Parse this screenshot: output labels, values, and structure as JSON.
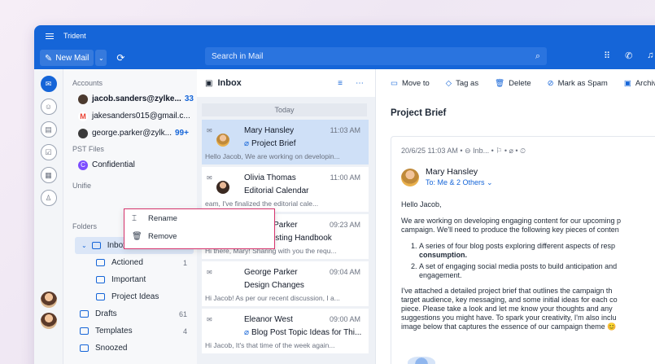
{
  "app": {
    "title": "Trident"
  },
  "toolbar": {
    "new_mail": "New Mail",
    "search_placeholder": "Search in Mail"
  },
  "accounts": {
    "label": "Accounts",
    "items": [
      {
        "name": "jacob.sanders@zylke...",
        "count": "33",
        "bold": true,
        "color": "#4b3a2f"
      },
      {
        "name": "jakesanders015@gmail.c...",
        "count": "",
        "bold": false,
        "color": "#ea4335"
      },
      {
        "name": "george.parker@zylk...",
        "count": "99+",
        "bold": false,
        "color": "#3a3a3a"
      }
    ]
  },
  "pst": {
    "label": "PST Files",
    "items": [
      {
        "name": "Confidential",
        "color": "#7c4dff"
      }
    ]
  },
  "unified": {
    "label": "Unifie"
  },
  "context_menu": {
    "rename": "Rename",
    "remove": "Remove"
  },
  "folders": {
    "label": "Folders",
    "add": "+",
    "inbox": "Inbox",
    "items": [
      {
        "name": "Actioned",
        "count": "1"
      },
      {
        "name": "Important",
        "count": ""
      },
      {
        "name": "Project Ideas",
        "count": ""
      }
    ],
    "other": [
      {
        "name": "Drafts",
        "count": "61"
      },
      {
        "name": "Templates",
        "count": "4"
      },
      {
        "name": "Snoozed",
        "count": ""
      }
    ]
  },
  "inbox": {
    "title": "Inbox",
    "group": "Today",
    "mails": [
      {
        "from": "Mary Hansley",
        "time": "11:03 AM",
        "subject": "Project Brief",
        "attach": true,
        "preview": "Hello Jacob, We are working on developin..."
      },
      {
        "from": "Olivia Thomas",
        "time": "11:00 AM",
        "subject": "Editorial Calendar",
        "attach": false,
        "preview": "eam, I've finalized the editorial cale..."
      },
      {
        "from": "George Parker",
        "time": "09:23 AM",
        "subject": "A/B Testing Handbook",
        "attach": true,
        "preview": "Hi there, Mary! Sharing with you the requ..."
      },
      {
        "from": "George Parker",
        "time": "09:04 AM",
        "subject": "Design Changes",
        "attach": false,
        "preview": "Hi Jacob! As per our recent discussion, I a..."
      },
      {
        "from": "Eleanor West",
        "time": "09:00 AM",
        "subject": "Blog Post Topic Ideas for Thi...",
        "attach": true,
        "preview": "Hi Jacob, It's that time of the week again..."
      }
    ]
  },
  "reading": {
    "tools": [
      "Move to",
      "Tag as",
      "Delete",
      "Mark as Spam",
      "Archive"
    ],
    "subject": "Project Brief",
    "meta": "20/6/25 11:03 AM  •  ⊖ Inb...  •  ⚐  •  ⌀  •  ⏲",
    "sender": "Mary Hansley",
    "to": "To: Me & 2 Others  ⌄",
    "greeting": "Hello Jacob,",
    "p1a": "We are working on developing engaging content for our upcoming p",
    "p1b": "campaign. We'll need to produce the following key pieces of conten",
    "li1a": "A series of four blog posts exploring different aspects of resp",
    "li1b": "consumption.",
    "li2a": "A set of engaging social media posts to build anticipation and",
    "li2b": "engagement.",
    "p2a": "I've attached a detailed project brief that outlines the campaign th",
    "p2b": "target audience, key messaging, and some initial ideas for each co",
    "p2c": "piece. Please take a look and let me know your thoughts and any",
    "p2d": "suggestions you might have. To spark your creativity, I'm also inclu",
    "p2e": "image below that captures the essence of our campaign theme 😊"
  }
}
